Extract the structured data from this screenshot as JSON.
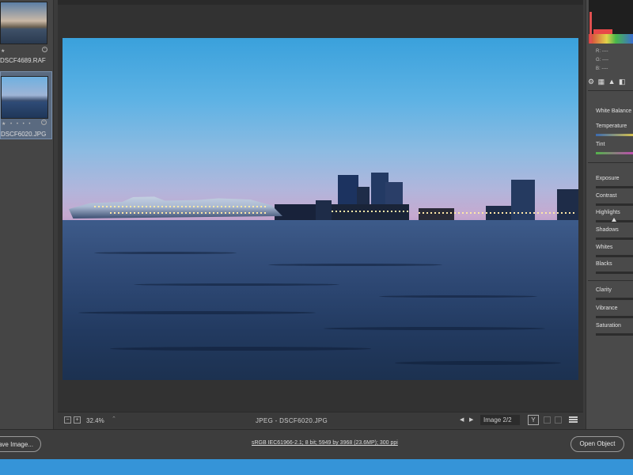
{
  "filmstrip": {
    "items": [
      {
        "name": "DSCF4689.RAF",
        "rating": "★",
        "selected": false
      },
      {
        "name": "DSCF6020.JPG",
        "rating": "★ • • • •",
        "selected": true
      }
    ]
  },
  "preview": {
    "zoom_level": "32.4%",
    "file_info": "JPEG  -  DSCF6020.JPG",
    "image_count": "Image 2/2",
    "y_button": "Y"
  },
  "right_panel": {
    "rgb_readout": [
      "R:  ----",
      "G:  ----",
      "B:  ----"
    ],
    "tool_icons": "⚙ ▦ ▲ ◧",
    "adjustments": {
      "white_balance": "White Balance",
      "temperature": "Temperature",
      "tint": "Tint",
      "exposure": "Exposure",
      "contrast": "Contrast",
      "highlights": "Highlights",
      "shadows": "Shadows",
      "whites": "Whites",
      "blacks": "Blacks",
      "clarity": "Clarity",
      "vibrance": "Vibrance",
      "saturation": "Saturation"
    }
  },
  "action_bar": {
    "save_label": "Save Image...",
    "workflow_info": "sRGB IEC61966-2.1; 8 bit; 5949 by 3968 (23.6MP); 300 ppi",
    "open_label": "Open Object"
  },
  "colors": {
    "accent_blue": "#3594d8",
    "panel_bg": "#4a4a4a",
    "canvas_bg": "#323232"
  }
}
